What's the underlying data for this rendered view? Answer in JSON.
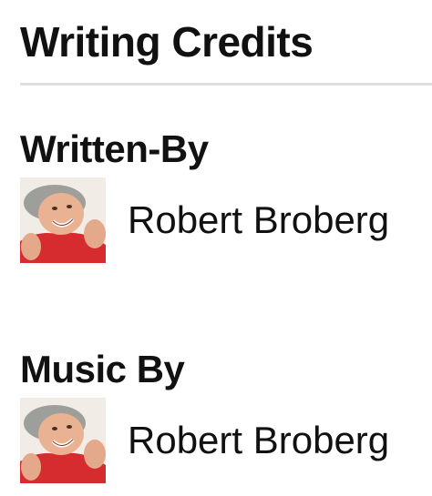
{
  "page": {
    "title": "Writing Credits"
  },
  "sections": [
    {
      "heading": "Written-By",
      "credits": [
        {
          "name": "Robert Broberg",
          "avatar_icon": "person-photo"
        }
      ]
    },
    {
      "heading": "Music By",
      "credits": [
        {
          "name": "Robert Broberg",
          "avatar_icon": "person-photo"
        }
      ]
    }
  ],
  "colors": {
    "text": "#111111",
    "divider": "#dedede",
    "background": "#ffffff"
  }
}
